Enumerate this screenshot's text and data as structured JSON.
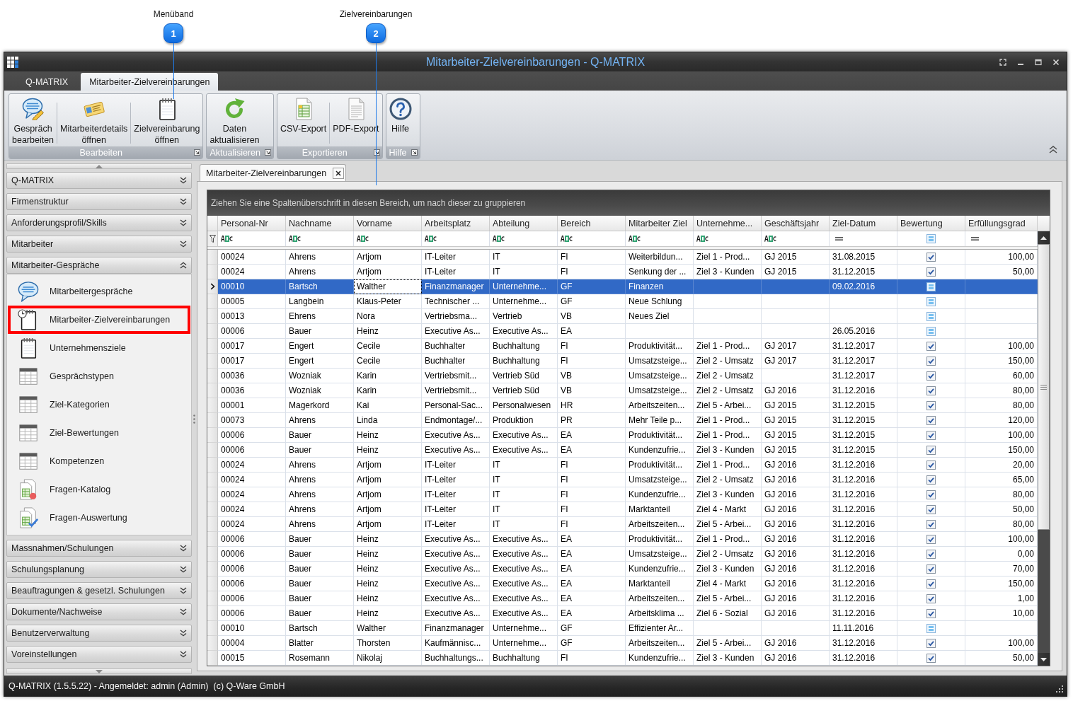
{
  "callouts": [
    {
      "number": "1",
      "label": "Menüband"
    },
    {
      "number": "2",
      "label": "Zielvereinbarungen"
    }
  ],
  "window": {
    "title": "Mitarbeiter-Zielvereinbarungen - Q-MATRIX"
  },
  "ribbon_tabs": [
    {
      "label": "Q-MATRIX",
      "selected": false
    },
    {
      "label": "Mitarbeiter-Zielvereinbarungen",
      "selected": true
    }
  ],
  "ribbon": {
    "groups": [
      {
        "label": "Bearbeiten",
        "buttons": [
          "Gespräch\nbearbeiten",
          "Mitarbeiterdetails\nöffnen",
          "Zielvereinbarung\nöffnen"
        ]
      },
      {
        "label": "Aktualisieren",
        "buttons": [
          "Daten\naktualisieren"
        ]
      },
      {
        "label": "Exportieren",
        "buttons": [
          "CSV-Export",
          "PDF-Export"
        ]
      },
      {
        "label": "Hilfe",
        "buttons": [
          "Hilfe"
        ]
      }
    ]
  },
  "sidebar": {
    "sections": [
      {
        "label": "Q-MATRIX",
        "expanded": false
      },
      {
        "label": "Firmenstruktur",
        "expanded": false
      },
      {
        "label": "Anforderungsprofil/Skills",
        "expanded": false
      },
      {
        "label": "Mitarbeiter",
        "expanded": false
      },
      {
        "label": "Mitarbeiter-Gespräche",
        "expanded": true,
        "items": [
          {
            "label": "Mitarbeitergespräche",
            "highlighted": false
          },
          {
            "label": "Mitarbeiter-Zielvereinbarungen",
            "highlighted": true
          },
          {
            "label": "Unternehmensziele",
            "highlighted": false
          },
          {
            "label": "Gesprächstypen",
            "highlighted": false
          },
          {
            "label": "Ziel-Kategorien",
            "highlighted": false
          },
          {
            "label": "Ziel-Bewertungen",
            "highlighted": false
          },
          {
            "label": "Kompetenzen",
            "highlighted": false
          },
          {
            "label": "Fragen-Katalog",
            "highlighted": false
          },
          {
            "label": "Fragen-Auswertung",
            "highlighted": false
          }
        ]
      },
      {
        "label": "Massnahmen/Schulungen",
        "expanded": false
      },
      {
        "label": "Schulungsplanung",
        "expanded": false
      },
      {
        "label": "Beauftragungen & gesetzl. Schulungen",
        "expanded": false
      },
      {
        "label": "Dokumente/Nachweise",
        "expanded": false
      },
      {
        "label": "Benutzerverwaltung",
        "expanded": false
      },
      {
        "label": "Voreinstellungen",
        "expanded": false
      }
    ]
  },
  "document_tabs": [
    {
      "label": "Mitarbeiter-Zielvereinbarungen",
      "selected": true
    }
  ],
  "grid": {
    "group_panel_hint": "Ziehen Sie eine Spaltenüberschrift in diesen Bereich, um nach dieser zu gruppieren",
    "columns": [
      {
        "label": "Personal-Nr",
        "kind": "text",
        "focused": false
      },
      {
        "label": "Nachname",
        "kind": "text",
        "focused": false
      },
      {
        "label": "Vorname",
        "kind": "text",
        "focused": true
      },
      {
        "label": "Arbeitsplatz",
        "kind": "text",
        "focused": false
      },
      {
        "label": "Abteilung",
        "kind": "text",
        "focused": false
      },
      {
        "label": "Bereich",
        "kind": "text",
        "focused": false
      },
      {
        "label": "Mitarbeiter Ziel",
        "kind": "text",
        "focused": false
      },
      {
        "label": "Unternehme...",
        "kind": "text",
        "focused": false
      },
      {
        "label": "Geschäftsjahr",
        "kind": "text",
        "focused": false
      },
      {
        "label": "Ziel-Datum",
        "kind": "date",
        "focused": false
      },
      {
        "label": "Bewertung",
        "kind": "check",
        "focused": false
      },
      {
        "label": "Erfüllungsgrad",
        "kind": "number",
        "focused": false
      }
    ],
    "rows": [
      {
        "cells": [
          "00024",
          "Ahrens",
          "Artjom",
          "IT-Leiter",
          "IT",
          "FI",
          "Weiterbildun...",
          "Ziel 1 - Prod...",
          "GJ 2015",
          "31.08.2015",
          null,
          "100,00"
        ],
        "rated": true,
        "selected": false
      },
      {
        "cells": [
          "00024",
          "Ahrens",
          "Artjom",
          "IT-Leiter",
          "IT",
          "FI",
          "Senkung der ...",
          "Ziel 3 - Kunden",
          "GJ 2015",
          "31.12.2015",
          null,
          "50,00"
        ],
        "rated": true,
        "selected": false
      },
      {
        "cells": [
          "00010",
          "Bartsch",
          "Walther",
          "Finanzmanager",
          "Unternehme...",
          "GF",
          "Finanzen",
          null,
          null,
          "09.02.2016",
          null,
          null
        ],
        "rated": false,
        "selected": true
      },
      {
        "cells": [
          "00005",
          "Langbein",
          "Klaus-Peter",
          "Technischer ...",
          "Unternehme...",
          "GF",
          "Neue Schlung",
          null,
          null,
          null,
          null,
          null
        ],
        "rated": false,
        "selected": false
      },
      {
        "cells": [
          "00013",
          "Ehrens",
          "Nora",
          "Vertriebsma...",
          "Vertrieb",
          "VB",
          "Neues Ziel",
          null,
          null,
          null,
          null,
          null
        ],
        "rated": false,
        "selected": false
      },
      {
        "cells": [
          "00006",
          "Bauer",
          "Heinz",
          "Executive As...",
          "Executive As...",
          "EA",
          null,
          null,
          null,
          "26.05.2016",
          null,
          null
        ],
        "rated": false,
        "selected": false
      },
      {
        "cells": [
          "00017",
          "Engert",
          "Cecile",
          "Buchhalter",
          "Buchhaltung",
          "FI",
          "Produktivität...",
          "Ziel 1 - Prod...",
          "GJ 2017",
          "31.12.2017",
          null,
          "100,00"
        ],
        "rated": true,
        "selected": false
      },
      {
        "cells": [
          "00017",
          "Engert",
          "Cecile",
          "Buchhalter",
          "Buchhaltung",
          "FI",
          "Umsatzsteige...",
          "Ziel 2 - Umsatz",
          "GJ 2017",
          "31.12.2017",
          null,
          "150,00"
        ],
        "rated": true,
        "selected": false
      },
      {
        "cells": [
          "00036",
          "Wozniak",
          "Karin",
          "Vertriebsmit...",
          "Vertrieb Süd",
          "VB",
          "Umsatzsteige...",
          "Ziel 2 - Umsatz",
          null,
          "31.12.2017",
          null,
          "60,00"
        ],
        "rated": true,
        "selected": false
      },
      {
        "cells": [
          "00036",
          "Wozniak",
          "Karin",
          "Vertriebsmit...",
          "Vertrieb Süd",
          "VB",
          "Umsatzsteige...",
          "Ziel 2 - Umsatz",
          "GJ 2016",
          "31.12.2016",
          null,
          "80,00"
        ],
        "rated": true,
        "selected": false
      },
      {
        "cells": [
          "00001",
          "Magerkord",
          "Kai",
          "Personal-Sac...",
          "Personalwesen",
          "HR",
          "Arbeitszeiten...",
          "Ziel 5 - Arbei...",
          "GJ 2015",
          "31.12.2015",
          null,
          "80,00"
        ],
        "rated": true,
        "selected": false
      },
      {
        "cells": [
          "00073",
          "Ahrens",
          "Linda",
          "Endmontage/...",
          "Produktion",
          "PR",
          "Mehr Teile p...",
          "Ziel 1 - Prod...",
          "GJ 2015",
          "31.12.2015",
          null,
          "120,00"
        ],
        "rated": true,
        "selected": false
      },
      {
        "cells": [
          "00006",
          "Bauer",
          "Heinz",
          "Executive As...",
          "Executive As...",
          "EA",
          "Produktivität...",
          "Ziel 1 - Prod...",
          "GJ 2015",
          "31.12.2015",
          null,
          "100,00"
        ],
        "rated": true,
        "selected": false
      },
      {
        "cells": [
          "00006",
          "Bauer",
          "Heinz",
          "Executive As...",
          "Executive As...",
          "EA",
          "Kundenzufrie...",
          "Ziel 3 - Kunden",
          "GJ 2015",
          "31.12.2015",
          null,
          "150,00"
        ],
        "rated": true,
        "selected": false
      },
      {
        "cells": [
          "00024",
          "Ahrens",
          "Artjom",
          "IT-Leiter",
          "IT",
          "FI",
          "Produktivität...",
          "Ziel 1 - Prod...",
          "GJ 2016",
          "31.12.2016",
          null,
          "20,00"
        ],
        "rated": true,
        "selected": false
      },
      {
        "cells": [
          "00024",
          "Ahrens",
          "Artjom",
          "IT-Leiter",
          "IT",
          "FI",
          "Umsatzsteige...",
          "Ziel 2 - Umsatz",
          "GJ 2016",
          "31.12.2016",
          null,
          "65,00"
        ],
        "rated": true,
        "selected": false
      },
      {
        "cells": [
          "00024",
          "Ahrens",
          "Artjom",
          "IT-Leiter",
          "IT",
          "FI",
          "Kundenzufrie...",
          "Ziel 3 - Kunden",
          "GJ 2016",
          "31.12.2016",
          null,
          "80,00"
        ],
        "rated": true,
        "selected": false
      },
      {
        "cells": [
          "00024",
          "Ahrens",
          "Artjom",
          "IT-Leiter",
          "IT",
          "FI",
          "Marktanteil",
          "Ziel 4 - Markt",
          "GJ 2016",
          "31.12.2016",
          null,
          "50,00"
        ],
        "rated": true,
        "selected": false
      },
      {
        "cells": [
          "00024",
          "Ahrens",
          "Artjom",
          "IT-Leiter",
          "IT",
          "FI",
          "Arbeitszeiten...",
          "Ziel 5 - Arbei...",
          "GJ 2016",
          "31.12.2016",
          null,
          "80,00"
        ],
        "rated": true,
        "selected": false
      },
      {
        "cells": [
          "00006",
          "Bauer",
          "Heinz",
          "Executive As...",
          "Executive As...",
          "EA",
          "Produktivität...",
          "Ziel 1 - Prod...",
          "GJ 2016",
          "31.12.2016",
          null,
          "100,00"
        ],
        "rated": true,
        "selected": false
      },
      {
        "cells": [
          "00006",
          "Bauer",
          "Heinz",
          "Executive As...",
          "Executive As...",
          "EA",
          "Umsatzsteige...",
          "Ziel 2 - Umsatz",
          "GJ 2016",
          "31.12.2016",
          null,
          "0,00"
        ],
        "rated": true,
        "selected": false
      },
      {
        "cells": [
          "00006",
          "Bauer",
          "Heinz",
          "Executive As...",
          "Executive As...",
          "EA",
          "Kundenzufrie...",
          "Ziel 3 - Kunden",
          "GJ 2016",
          "31.12.2016",
          null,
          "70,00"
        ],
        "rated": true,
        "selected": false
      },
      {
        "cells": [
          "00006",
          "Bauer",
          "Heinz",
          "Executive As...",
          "Executive As...",
          "EA",
          "Marktanteil",
          "Ziel 4 - Markt",
          "GJ 2016",
          "31.12.2016",
          null,
          "150,00"
        ],
        "rated": true,
        "selected": false
      },
      {
        "cells": [
          "00006",
          "Bauer",
          "Heinz",
          "Executive As...",
          "Executive As...",
          "EA",
          "Arbeitszeiten...",
          "Ziel 5 - Arbei...",
          "GJ 2016",
          "31.12.2016",
          null,
          "1,00"
        ],
        "rated": true,
        "selected": false
      },
      {
        "cells": [
          "00006",
          "Bauer",
          "Heinz",
          "Executive As...",
          "Executive As...",
          "EA",
          "Arbeitsklima ...",
          "Ziel 6 - Sozial",
          "GJ 2016",
          "31.12.2016",
          null,
          "10,00"
        ],
        "rated": true,
        "selected": false
      },
      {
        "cells": [
          "00010",
          "Bartsch",
          "Walther",
          "Finanzmanager",
          "Unternehme...",
          "GF",
          "Effizienter Ar...",
          null,
          null,
          "11.11.2016",
          null,
          null
        ],
        "rated": false,
        "selected": false
      },
      {
        "cells": [
          "00004",
          "Blatter",
          "Thorsten",
          "Kaufmännisc...",
          "Unternehme...",
          "GF",
          "Arbeitszeiten...",
          "Ziel 5 - Arbei...",
          "GJ 2016",
          "31.12.2016",
          null,
          "100,00"
        ],
        "rated": true,
        "selected": false
      },
      {
        "cells": [
          "00015",
          "Rosemann",
          "Nikolaj",
          "Buchhaltungs...",
          "Buchhaltung",
          "FI",
          "Kundenzufrie...",
          "Ziel 3 - Kunden",
          "GJ 2016",
          "31.12.2016",
          null,
          "50,00"
        ],
        "rated": true,
        "selected": false
      }
    ]
  },
  "status_bar": {
    "session": "Q-MATRIX (1.5.5.22) - Angemeldet: admin (Admin)",
    "copyright": "(c) Q-Ware GmbH"
  }
}
